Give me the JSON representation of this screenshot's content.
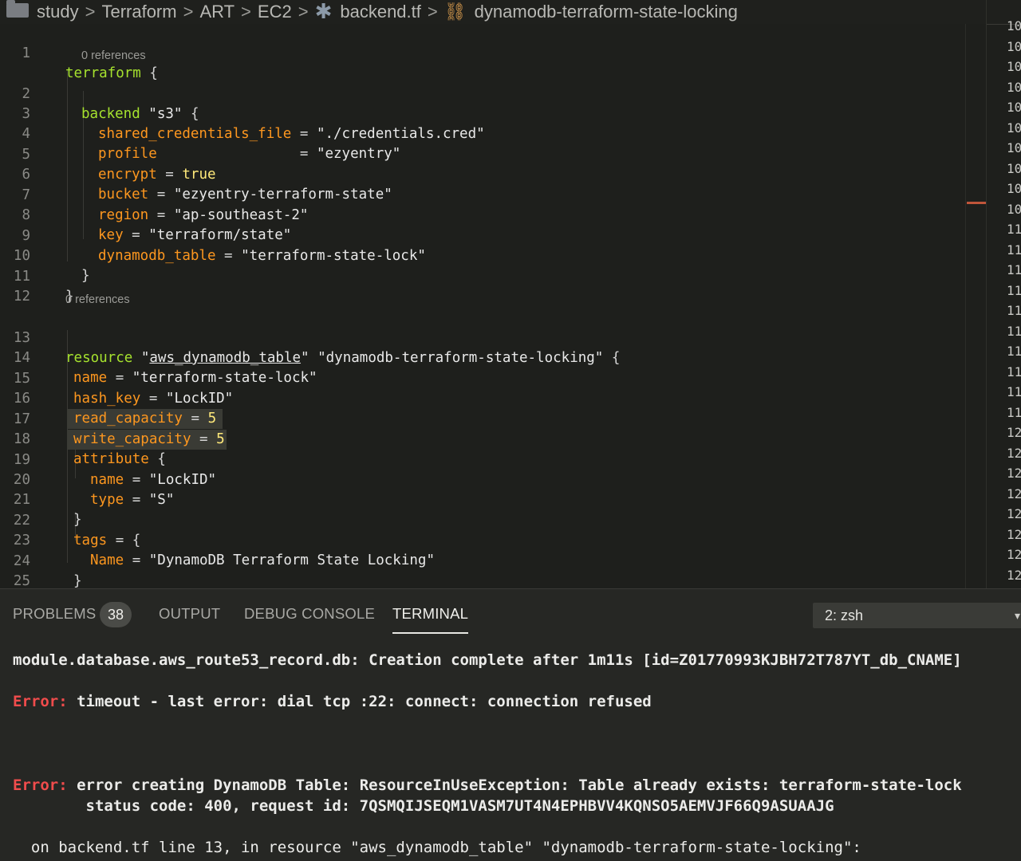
{
  "breadcrumb": {
    "items": [
      "study",
      "Terraform",
      "ART",
      "EC2",
      "backend.tf",
      "dynamodb-terraform-state-locking"
    ],
    "separator": ">"
  },
  "editor": {
    "codelens_1": "0 references",
    "codelens_2": "0 references",
    "lines": [
      {
        "n": "1"
      },
      {
        "n": "2"
      },
      {
        "n": "3"
      },
      {
        "n": "4"
      },
      {
        "n": "5"
      },
      {
        "n": "6"
      },
      {
        "n": "7"
      },
      {
        "n": "8"
      },
      {
        "n": "9"
      },
      {
        "n": "10"
      },
      {
        "n": "11"
      },
      {
        "n": "12"
      },
      {
        "n": "13"
      },
      {
        "n": "14"
      },
      {
        "n": "15"
      },
      {
        "n": "16"
      },
      {
        "n": "17"
      },
      {
        "n": "18"
      },
      {
        "n": "19"
      },
      {
        "n": "20"
      },
      {
        "n": "21"
      },
      {
        "n": "22"
      },
      {
        "n": "23"
      },
      {
        "n": "24"
      },
      {
        "n": "25"
      }
    ],
    "code": {
      "l1_kw": "terraform",
      "l1_rest": " {",
      "l2_kw": "backend",
      "l2_str": " \"s3\"",
      "l2_rest": " {",
      "l3_prop": "shared_credentials_file",
      "l3_eq": " = ",
      "l3_str": "\"./credentials.cred\"",
      "l4_prop": "profile",
      "l4_eq": "                 = ",
      "l4_str": "\"ezyentry\"",
      "l5_prop": "encrypt",
      "l5_eq": " = ",
      "l5_val": "true",
      "l6_prop": "bucket",
      "l6_eq": " = ",
      "l6_str": "\"ezyentry-terraform-state\"",
      "l7_prop": "region",
      "l7_eq": " = ",
      "l7_str": "\"ap-southeast-2\"",
      "l8_prop": "key",
      "l8_eq": " = ",
      "l8_str": "\"terraform/state\"",
      "l9_prop": "dynamodb_table",
      "l9_eq": " = ",
      "l9_str": "\"terraform-state-lock\"",
      "l10": "}",
      "l11": "}",
      "l13_kw": "resource",
      "l13_q1": " \"",
      "l13_type": "aws_dynamodb_table",
      "l13_q2": "\"",
      "l13_name": " \"dynamodb-terraform-state-locking\"",
      "l13_rest": " {",
      "l14_prop": "name",
      "l14_eq": " = ",
      "l14_str": "\"terraform-state-lock\"",
      "l15_prop": "hash_key",
      "l15_eq": " = ",
      "l15_str": "\"LockID\"",
      "l16_prop": "read_capacity",
      "l16_eq": " = ",
      "l16_num": "5",
      "l17_prop": "write_capacity",
      "l17_eq": " = ",
      "l17_num": "5",
      "l18_prop": "attribute",
      "l18_rest": " {",
      "l19_prop": "name",
      "l19_eq": " = ",
      "l19_str": "\"LockID\"",
      "l20_prop": "type",
      "l20_eq": " = ",
      "l20_str": "\"S\"",
      "l21": "}",
      "l22_prop": "tags",
      "l22_rest": " = {",
      "l23_prop": "Name",
      "l23_eq": " = ",
      "l23_str": "\"DynamoDB Terraform State Locking\"",
      "l24": "}",
      "l25": "}"
    }
  },
  "minimap_numbers": [
    "10",
    "10",
    "10",
    "10",
    "10",
    "10",
    "10",
    "10",
    "10",
    "10",
    "11",
    "11",
    "11",
    "11",
    "11",
    "11",
    "11",
    "11",
    "11",
    "11",
    "12",
    "12",
    "12",
    "12",
    "12",
    "12",
    "12",
    "12",
    "12"
  ],
  "panel": {
    "tabs": {
      "problems": "PROBLEMS",
      "problems_count": "38",
      "output": "OUTPUT",
      "debug": "DEBUG CONSOLE",
      "terminal": "TERMINAL"
    },
    "terminal_select": "2: zsh",
    "terminal_lines": {
      "t1": "module.database.aws_route53_record.db: Creation complete after 1m11s [id=Z01770993KJBH72T787YT_db_CNAME]",
      "t2_err": "Error:",
      "t2_msg": " timeout - last error: dial tcp :22: connect: connection refused",
      "t3_err": "Error:",
      "t3_msg": " error creating DynamoDB Table: ResourceInUseException: Table already exists: terraform-state-lock",
      "t4": "        status code: 400, request id: 7QSMQIJSEQM1VASM7UT4N4EPHBVV4KQNSO5AEMVJF66Q9ASUAAJG",
      "t5": "  on backend.tf line 13, in resource \"aws_dynamodb_table\" \"dynamodb-terraform-state-locking\":"
    }
  },
  "colors": {
    "keyword": "#a6e22e",
    "property": "#fd971f",
    "string": "#e6db74",
    "error": "#f14c4c",
    "background": "#1e1f1c"
  }
}
